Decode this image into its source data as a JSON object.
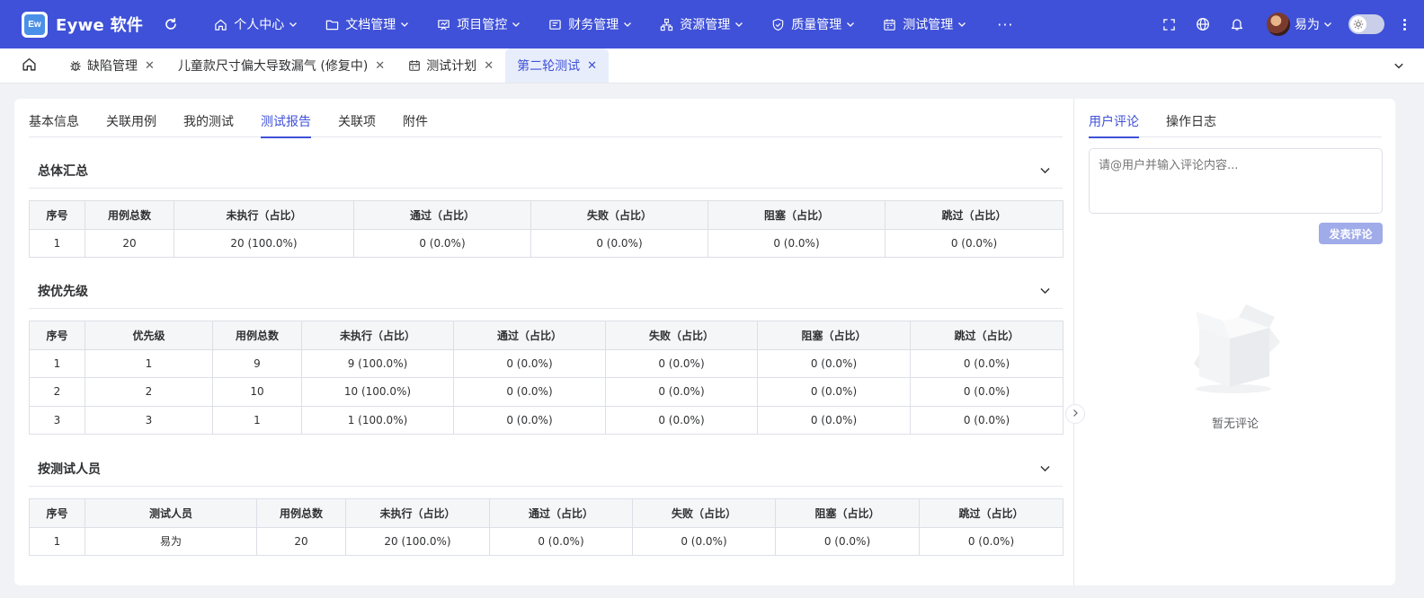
{
  "app": {
    "logo_text": "Ew",
    "title": "Eywe 软件"
  },
  "top_menu": [
    {
      "label": "个人中心",
      "icon": "home-icon"
    },
    {
      "label": "文档管理",
      "icon": "folder-icon"
    },
    {
      "label": "项目管控",
      "icon": "project-icon"
    },
    {
      "label": "财务管理",
      "icon": "finance-icon"
    },
    {
      "label": "资源管理",
      "icon": "resource-icon"
    },
    {
      "label": "质量管理",
      "icon": "shield-icon"
    },
    {
      "label": "测试管理",
      "icon": "calendar-icon"
    }
  ],
  "more_label": "···",
  "user": {
    "name": "易为"
  },
  "page_tabs": [
    {
      "label": "缺陷管理",
      "icon": "bug-icon"
    },
    {
      "label": "儿童款尺寸偏大导致漏气 (修复中)",
      "icon": ""
    },
    {
      "label": "测试计划",
      "icon": "calendar-icon"
    },
    {
      "label": "第二轮测试",
      "icon": "",
      "active": true
    }
  ],
  "close_glyph": "✕",
  "inner_tabs": [
    "基本信息",
    "关联用例",
    "我的测试",
    "测试报告",
    "关联项",
    "附件"
  ],
  "sections": {
    "summary": {
      "title": "总体汇总",
      "headers": [
        "序号",
        "用例总数",
        "未执行（占比）",
        "通过（占比）",
        "失败（占比）",
        "阻塞（占比）",
        "跳过（占比）"
      ],
      "rows": [
        [
          "1",
          "20",
          "20 (100.0%)",
          "0 (0.0%)",
          "0 (0.0%)",
          "0 (0.0%)",
          "0 (0.0%)"
        ]
      ]
    },
    "priority": {
      "title": "按优先级",
      "headers": [
        "序号",
        "优先级",
        "用例总数",
        "未执行（占比）",
        "通过（占比）",
        "失败（占比）",
        "阻塞（占比）",
        "跳过（占比）"
      ],
      "rows": [
        [
          "1",
          "1",
          "9",
          "9 (100.0%)",
          "0 (0.0%)",
          "0 (0.0%)",
          "0 (0.0%)",
          "0 (0.0%)"
        ],
        [
          "2",
          "2",
          "10",
          "10 (100.0%)",
          "0 (0.0%)",
          "0 (0.0%)",
          "0 (0.0%)",
          "0 (0.0%)"
        ],
        [
          "3",
          "3",
          "1",
          "1 (100.0%)",
          "0 (0.0%)",
          "0 (0.0%)",
          "0 (0.0%)",
          "0 (0.0%)"
        ]
      ]
    },
    "tester": {
      "title": "按测试人员",
      "headers": [
        "序号",
        "测试人员",
        "用例总数",
        "未执行（占比）",
        "通过（占比）",
        "失败（占比）",
        "阻塞（占比）",
        "跳过（占比）"
      ],
      "rows": [
        [
          "1",
          "易为",
          "20",
          "20 (100.0%)",
          "0 (0.0%)",
          "0 (0.0%)",
          "0 (0.0%)",
          "0 (0.0%)"
        ]
      ]
    }
  },
  "right_panel": {
    "tabs": [
      "用户评论",
      "操作日志"
    ],
    "comment_placeholder": "请@用户并输入评论内容...",
    "submit_label": "发表评论",
    "empty_text": "暂无评论"
  },
  "colors": {
    "primary": "#3f51d8",
    "disabled_button": "#a0abe9"
  }
}
